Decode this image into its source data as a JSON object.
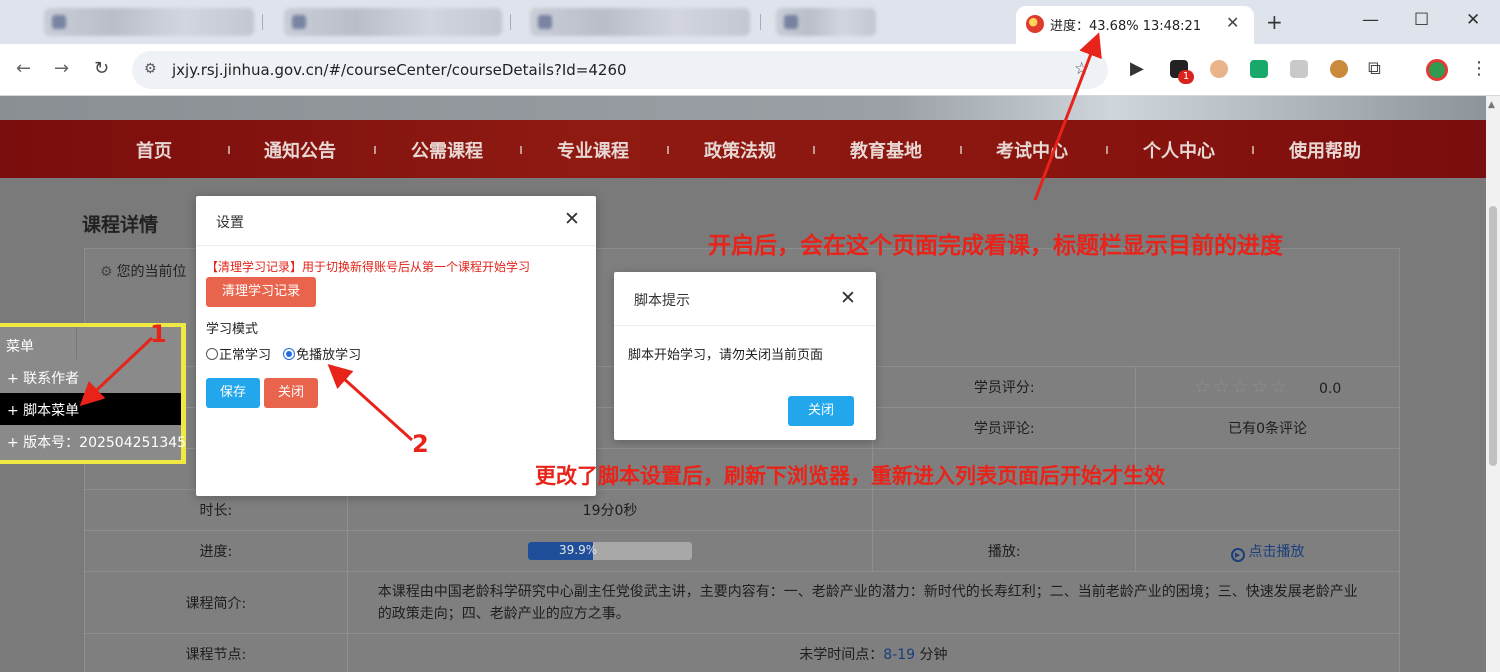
{
  "browser": {
    "active_tab_title": "进度：43.68% 13:48:21",
    "url": "jxjy.rsj.jinhua.gov.cn/#/courseCenter/courseDetails?Id=4260",
    "extension_badge": "1"
  },
  "nav": {
    "items": [
      "首页",
      "通知公告",
      "公需课程",
      "专业课程",
      "政策法规",
      "教育基地",
      "考试中心",
      "个人中心",
      "使用帮助"
    ]
  },
  "page": {
    "section_title": "课程详情",
    "current_position_label": "您的当前位"
  },
  "course_table": {
    "rating_label": "学员评分:",
    "rating_value": "0.0",
    "comment_label": "学员评论:",
    "comment_value": "已有0条评论",
    "duration_label": "时长:",
    "duration_value": "19分0秒",
    "progress_label": "进度:",
    "progress_value": 39.9,
    "progress_text": "39.9%",
    "play_label": "播放:",
    "play_link": "点击播放",
    "intro_label": "课程简介:",
    "intro_text": "本课程由中国老龄科学研究中心副主任党俊武主讲，主要内容有：一、老龄产业的潜力：新时代的长寿红利；二、当前老龄产业的困境；三、快速发展老龄产业的政策走向；四、老龄产业的应方之事。",
    "node_label": "课程节点:",
    "node_prefix": "未学时间点：",
    "node_range": "8-19",
    "node_suffix": " 分钟"
  },
  "script_menu": {
    "title": "菜单",
    "items": [
      "+ 联系作者",
      "+ 脚本菜单",
      "+ 版本号：202504251345"
    ]
  },
  "settings_dialog": {
    "title": "设置",
    "warning": "【清理学习记录】用于切换新得账号后从第一个课程开始学习",
    "clear_button": "清理学习记录",
    "mode_label": "学习模式",
    "mode_normal": "正常学习",
    "mode_free": "免播放学习",
    "save_button": "保存",
    "close_button": "关闭"
  },
  "hint_dialog": {
    "title": "脚本提示",
    "body": "脚本开始学习，请勿关闭当前页面",
    "close_button": "关闭"
  },
  "annotations": {
    "top_note": "开启后，会在这个页面完成看课，标题栏显示目前的进度",
    "bottom_note": "更改了脚本设置后，刷新下浏览器，重新进入列表页面后开始才生效",
    "marker_1": "1",
    "marker_2": "2"
  },
  "colors": {
    "accent_red": "#e8231a",
    "nav_red": "#8f1a12",
    "button_blue": "#22a7ec",
    "button_red": "#e8644c"
  }
}
